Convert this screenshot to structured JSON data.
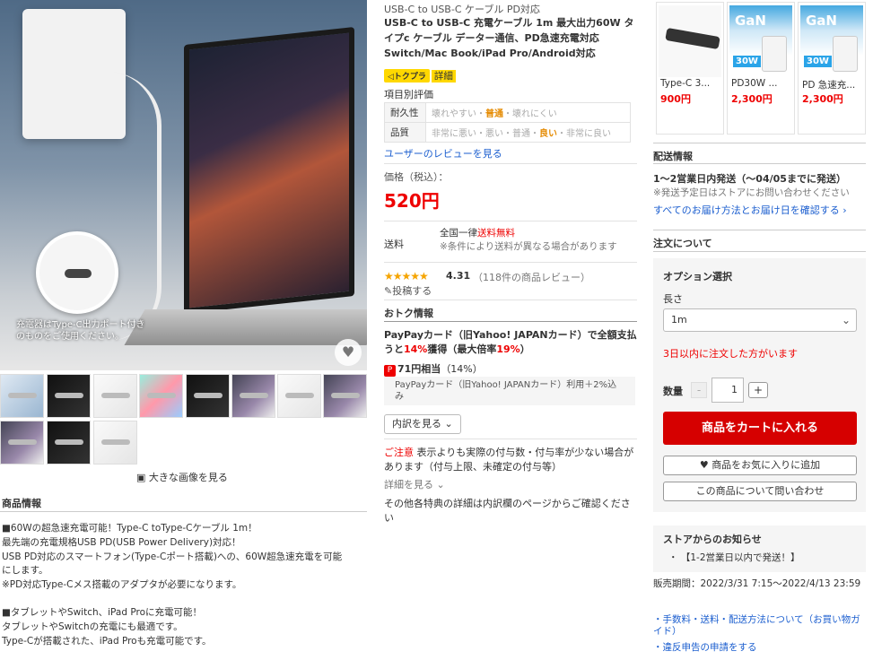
{
  "main_image": {
    "caption": "充電器はType-C出力ポート付きのものをご使用ください。"
  },
  "gallery": {
    "big_image_link": "大きな画像を見る"
  },
  "product_info": {
    "title": "商品情報",
    "lines": [
      "■60Wの超急速充電可能！Type-C toType-Cケーブル 1m！",
      "最先端の充電規格USB PD(USB Power Delivery)対応！",
      "USB PD対応のスマートフォン(Type-Cポート搭載)への、60W超急速充電を可能",
      "にします。",
      "※PD対応Type-Cメス搭載のアダプタが必要になります。",
      "",
      "■タブレットやSwitch、iPad Proに充電可能！",
      "タブレットやSwitchの充電にも最適です。",
      "Type-Cが搭載された、iPad Proも充電可能です。"
    ]
  },
  "breadcrumb": "USB-C to USB-C ケーブル PD対応",
  "product_title": "USB-C to USB-C 充電ケーブル 1m 最大出力60W タイプc ケーブル データー通信、PD急速充電対応 Switch/Mac Book/iPad Pro/Android対応",
  "tokupla": {
    "badge": "◁トクプラ",
    "detail": "詳細"
  },
  "evaluation": {
    "title": "項目別評価",
    "rows": [
      {
        "label": "耐久性",
        "left": "壊れやすい",
        "sel": "普通",
        "right": "壊れにくい"
      },
      {
        "label": "品質",
        "left": "非常に悪い・悪い・普通・",
        "sel": "良い",
        "right": "・非常に良い"
      }
    ],
    "review_link": "ユーザーのレビューを見る"
  },
  "price": {
    "label": "価格（税込）：",
    "value": "520円"
  },
  "shipping": {
    "label": "送料",
    "line1_prefix": "全国一律",
    "line1_red": "送料無料",
    "line2": "※条件により送料が異なる場合があります"
  },
  "rating": {
    "stars": "★★★★★",
    "value": "4.31",
    "count": "（118件の商品レビュー）",
    "post_link": "投稿する"
  },
  "otoku": {
    "title": "おトク情報",
    "paypay_prefix": "PayPayカード（旧Yahoo! JAPANカード）で全額支払うと",
    "paypay_pct": "14%",
    "paypay_mid": "獲得（最大倍率",
    "paypay_max": "19%",
    "paypay_suffix": "）",
    "points": "71円相当",
    "points_pct": "（14%）",
    "points_sub": "PayPayカード（旧Yahoo! JAPANカード）利用＋2%込み",
    "breakdown_btn": "内訳を見る",
    "caution_prefix": "ご注意",
    "caution_text": "表示よりも実際の付与数・付与率が少ない場合があります（付与上限、未確定の付与等）",
    "detail_more": "詳細を見る",
    "other_note": "その他各特典の詳細は内訳欄のページからご確認ください"
  },
  "recommend": [
    {
      "name": "Type-C 3...",
      "price": "900円"
    },
    {
      "name": "PD30W ...",
      "price": "2,300円",
      "brand": "GaN",
      "watt": "30W"
    },
    {
      "name": "PD 急速充...",
      "price": "2,300円",
      "brand": "GaN",
      "watt": "30W"
    }
  ],
  "delivery": {
    "title": "配送情報",
    "main": "1～2営業日内発送（～04/05までに発送）",
    "note": "※発送予定日はストアにお問い合わせください",
    "link": "すべてのお届け方法とお届け日を確認する"
  },
  "order": {
    "title": "注文について",
    "option_title": "オプション選択",
    "length_label": "長さ",
    "length_value": "1m",
    "soon_text": "3日以内に注文した方がいます",
    "qty_label": "数量",
    "qty_value": "1",
    "cart_btn": "商品をカートに入れる",
    "fav_btn": "商品をお気に入りに追加",
    "inquiry_btn": "この商品について問い合わせ"
  },
  "notice": {
    "title": "ストアからのお知らせ",
    "item": "【1-2営業日以内で発送！】"
  },
  "sale_period": "販売期間：2022/3/31 7:15～2022/4/13 23:59",
  "links": {
    "fees": "・手数料・送料・配送方法について（お買い物ガイド）",
    "report": "・違反申告の申請をする"
  }
}
